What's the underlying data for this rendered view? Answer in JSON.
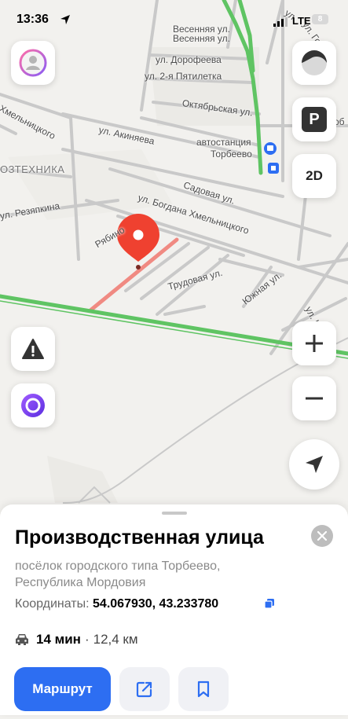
{
  "status_bar": {
    "time": "13:36",
    "network": "LTE",
    "battery": "8"
  },
  "map": {
    "labels": {
      "vesennyaya1": "Весенняя ул.",
      "vesennyaya2": "Весенняя ул.",
      "dorofeeva": "ул. Дорофеева",
      "pyatiletka": "ул. 2-я Пятилетка",
      "oktyabrskaya": "Октябрьская ул.",
      "khmelnitskogo_top": "Хмельницкого",
      "akinyaeva": "ул. Акиняева",
      "avtostanciya": "автостанция",
      "torbeevo": "Торбеево",
      "ozteh": "ОЗТЕХНИКА",
      "sadovaya": "Садовая ул.",
      "bogdan": "ул. Богдана Хмельницкого",
      "rezyapkina": "ул. Резяпкина",
      "ryabino": "Рябино",
      "trudovaya": "Трудовая ул.",
      "yuzhnaya": "Южная ул.",
      "ku": "ул. Ку",
      "golova": "ул. Голова",
      "ul_top": "ул.",
      "tob": "об"
    },
    "controls": {
      "two_d": "2D",
      "parking": "P",
      "zoom_in": "+",
      "zoom_out": "−"
    }
  },
  "place_card": {
    "title": "Производственная улица",
    "address_line1": "посёлок городского типа Торбеево,",
    "address_line2": "Республика Мордовия",
    "coords_label": "Координаты:",
    "coords_value": "54.067930, 43.233780",
    "duration": "14 мин",
    "separator": "·",
    "distance": "12,4 км",
    "route_button": "Маршрут"
  },
  "colors": {
    "accent": "#2d6ef2",
    "pin": "#ef4130",
    "road_green": "#5fc463",
    "route_red": "#f08a82"
  }
}
